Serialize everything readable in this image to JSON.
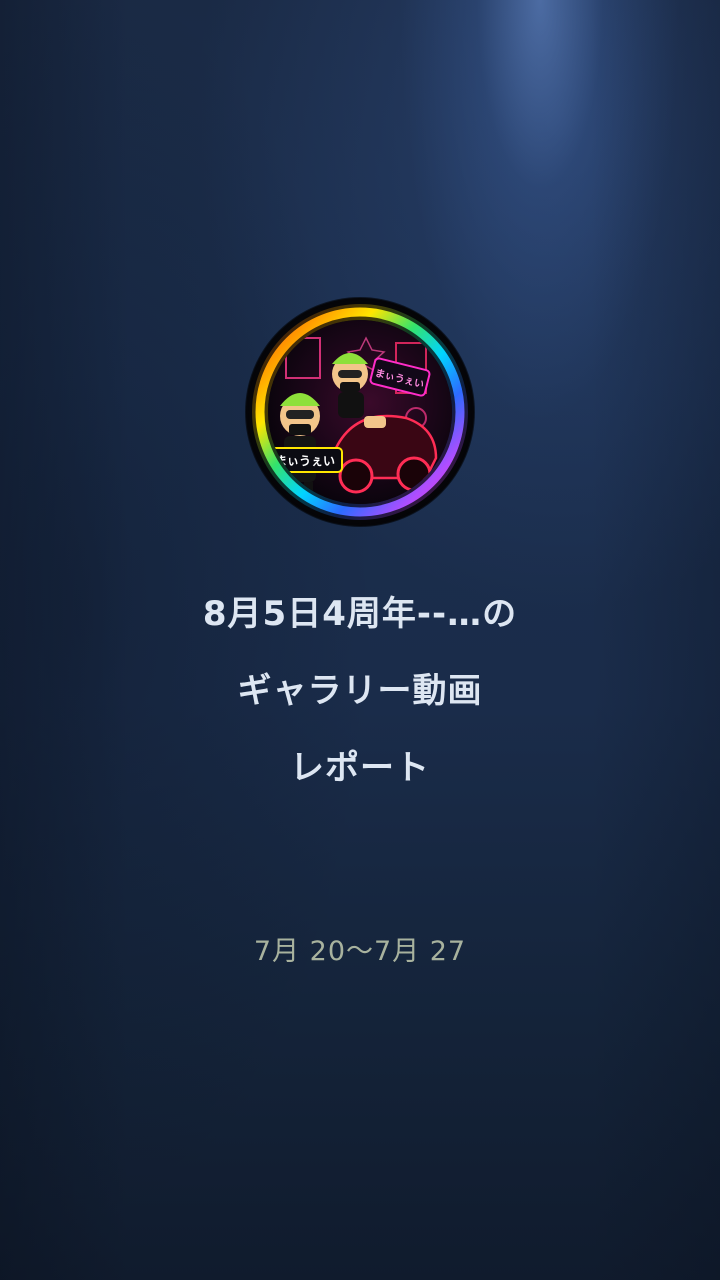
{
  "report": {
    "title_line1": "8月5日4周年--…の",
    "title_line2": "ギャラリー動画",
    "title_line3": "レポート",
    "date_range": "7月 20〜7月 27"
  },
  "avatar": {
    "sign_text_left": "まぃうぇい",
    "sign_text_right": "まぃうぇい",
    "ring_colors": [
      "#ff2d55",
      "#ff9500",
      "#ffe600",
      "#34e36b",
      "#00d4ff",
      "#2d6bff",
      "#b14dff",
      "#ff2dc8"
    ],
    "icon": "profile-avatar"
  },
  "colors": {
    "title": "#dde6f2",
    "date": "#a8b29e"
  }
}
